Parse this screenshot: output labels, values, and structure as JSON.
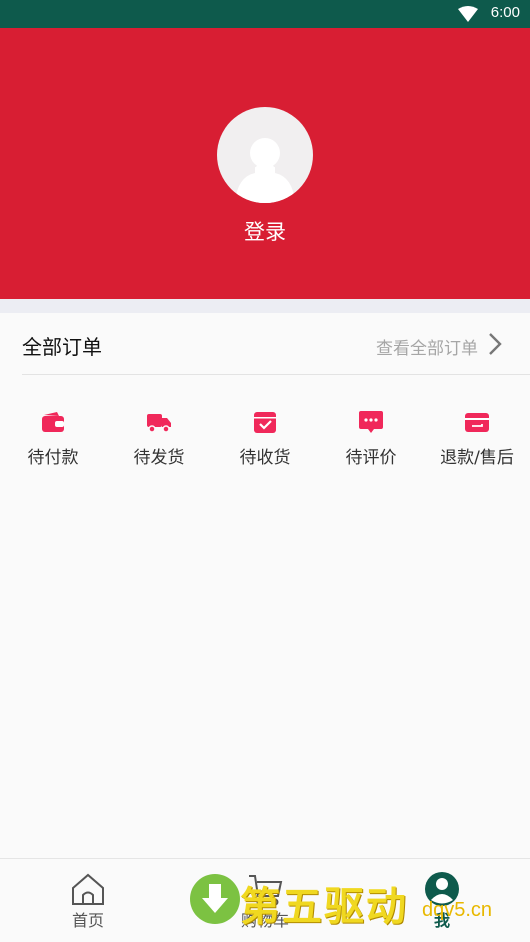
{
  "status_bar": {
    "time": "6:00",
    "wifi_icon": "wifi-icon"
  },
  "profile": {
    "avatar_icon": "avatar-placeholder-icon",
    "login_label": "登录"
  },
  "orders": {
    "title": "全部订单",
    "view_all": "查看全部订单",
    "statuses": [
      {
        "label": "待付款",
        "icon": "wallet-icon"
      },
      {
        "label": "待发货",
        "icon": "truck-icon"
      },
      {
        "label": "待收货",
        "icon": "package-check-icon"
      },
      {
        "label": "待评价",
        "icon": "comment-icon"
      },
      {
        "label": "退款/售后",
        "icon": "refund-icon"
      }
    ]
  },
  "tabs": [
    {
      "label": "首页",
      "icon": "home-icon",
      "active": false
    },
    {
      "label": "购物车",
      "icon": "cart-icon",
      "active": false
    },
    {
      "label": "我",
      "icon": "user-icon",
      "active": true
    }
  ],
  "watermark": {
    "text": "第五驱动",
    "url": "dqv5.cn"
  },
  "colors": {
    "brand_red": "#d81e33",
    "status_bar": "#0e5a4c",
    "icon_pink": "#f0285a",
    "active_tab": "#0e5a4c"
  }
}
